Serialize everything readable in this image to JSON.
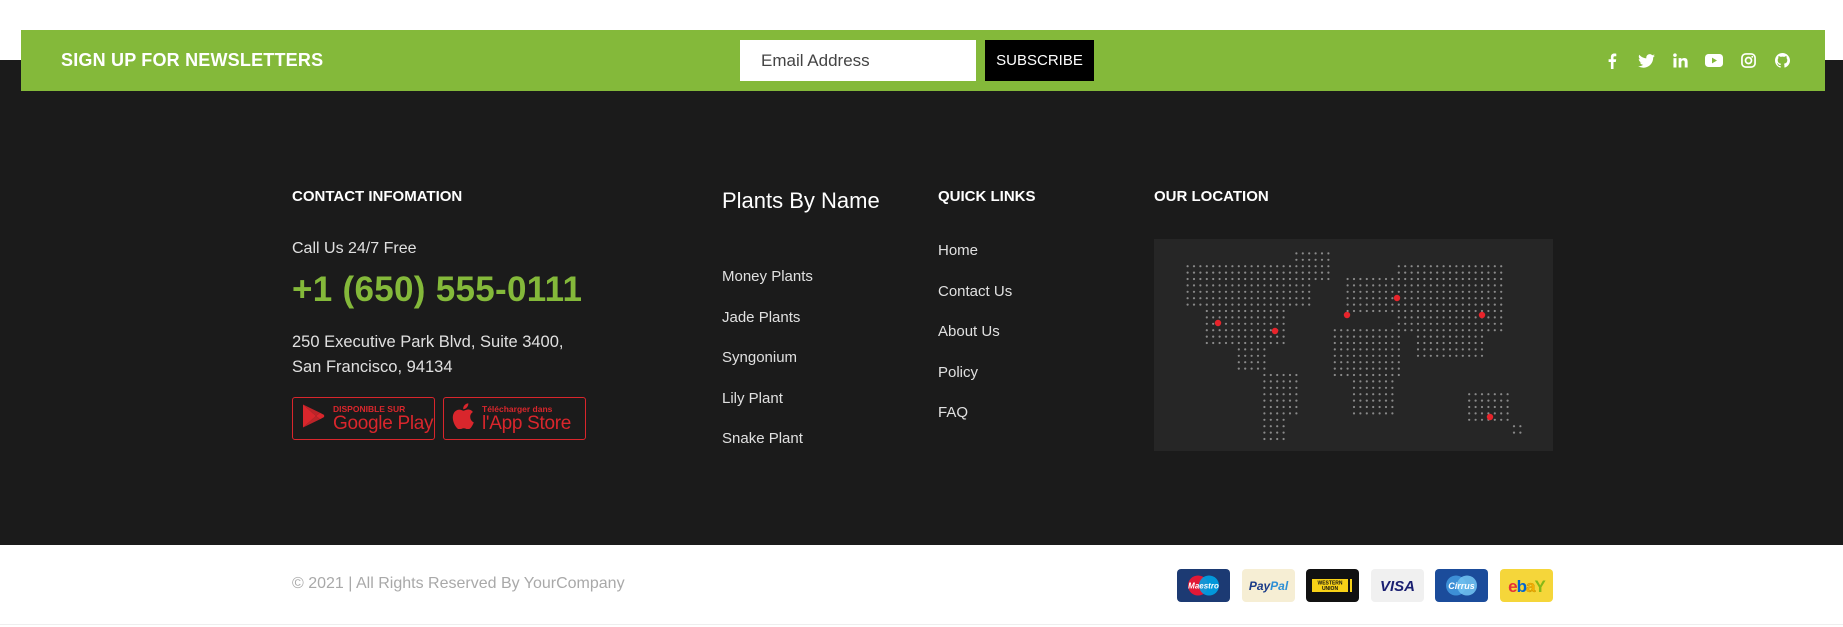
{
  "newsletter": {
    "title": "SIGN UP FOR NEWSLETTERS",
    "email_placeholder": "Email Address",
    "subscribe_label": "SUBSCRIBE",
    "socials": [
      "facebook-icon",
      "twitter-icon",
      "linkedin-icon",
      "youtube-icon",
      "instagram-icon",
      "github-icon"
    ]
  },
  "contact": {
    "heading": "CONTACT INFOMATION",
    "call_label": "Call Us 24/7 Free",
    "phone": "+1 (650) 555-0111",
    "address_line1": "250 Executive Park Blvd, Suite 3400,",
    "address_line2": "San Francisco, 94134",
    "google_play": {
      "small": "DISPONIBLE SUR",
      "big": "Google Play"
    },
    "app_store": {
      "small": "Télécharger dans",
      "big": "l'App Store"
    }
  },
  "plants": {
    "heading": "Plants By Name",
    "items": [
      "Money Plants",
      "Jade Plants",
      "Syngonium",
      "Lily Plant",
      "Snake Plant"
    ]
  },
  "quick_links": {
    "heading": "QUICK LINKS",
    "items": [
      "Home",
      "Contact Us",
      "About Us",
      "Policy",
      "FAQ"
    ]
  },
  "location": {
    "heading": "OUR LOCATION"
  },
  "footer": {
    "copyright": "© 2021 | All Rights Reserved By YourCompany",
    "payments": [
      {
        "name": "maestro-icon",
        "label": "Maestro"
      },
      {
        "name": "paypal-icon",
        "label": "PayPal"
      },
      {
        "name": "western-union-icon",
        "label": "WESTERN UNION"
      },
      {
        "name": "visa-icon",
        "label": "VISA"
      },
      {
        "name": "cirrus-icon",
        "label": "Cirrus"
      },
      {
        "name": "ebay-icon",
        "label": "ebay"
      }
    ]
  },
  "colors": {
    "accent_green": "#84b93a",
    "dark_bg": "#1b1b1b",
    "map_marker_red": "#e8242b"
  }
}
